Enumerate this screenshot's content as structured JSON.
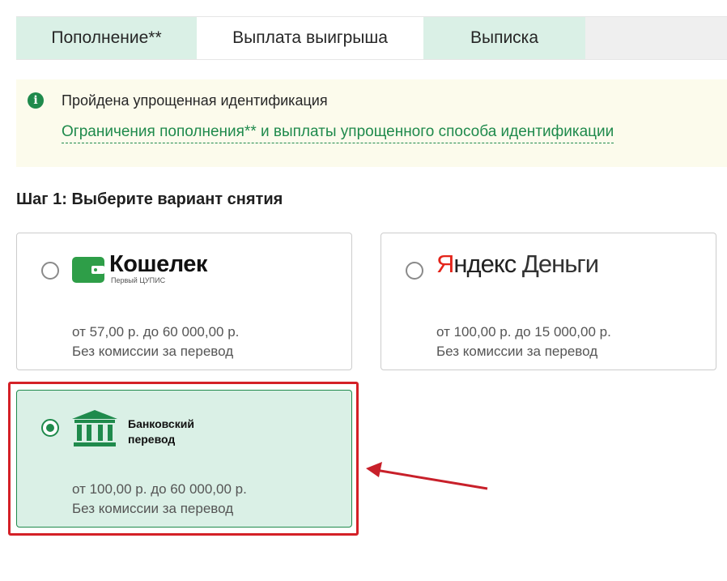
{
  "tabs": [
    {
      "label": "Пополнение**"
    },
    {
      "label": "Выплата выигрыша"
    },
    {
      "label": "Выписка"
    }
  ],
  "notice": {
    "icon": "info-icon",
    "title": "Пройдена упрощенная идентификация",
    "link": "Ограничения пополнения** и выплаты упрощенного способа идентификации"
  },
  "step": {
    "heading": "Шаг 1: Выберите вариант снятия"
  },
  "options": [
    {
      "logo_name": "Кошелек",
      "logo_sub": "Первый ЦУПИС",
      "range": "от 57,00 р. до 60 000,00 р.",
      "fee": "Без комиссии за перевод",
      "selected": false
    },
    {
      "logo_part1": "Я",
      "logo_part2": "ндекс",
      "logo_part3": "Деньги",
      "range": "от 100,00 р. до 15 000,00 р.",
      "fee": "Без комиссии за перевод",
      "selected": false
    },
    {
      "logo_name": "Банковский перевод",
      "range": "от 100,00 р. до 60 000,00 р.",
      "fee": "Без комиссии за перевод",
      "selected": true
    }
  ],
  "colors": {
    "accent": "#1f8a4c",
    "tab_bg": "#daf0e6",
    "notice_bg": "#fcfbec",
    "highlight": "#d42027"
  }
}
